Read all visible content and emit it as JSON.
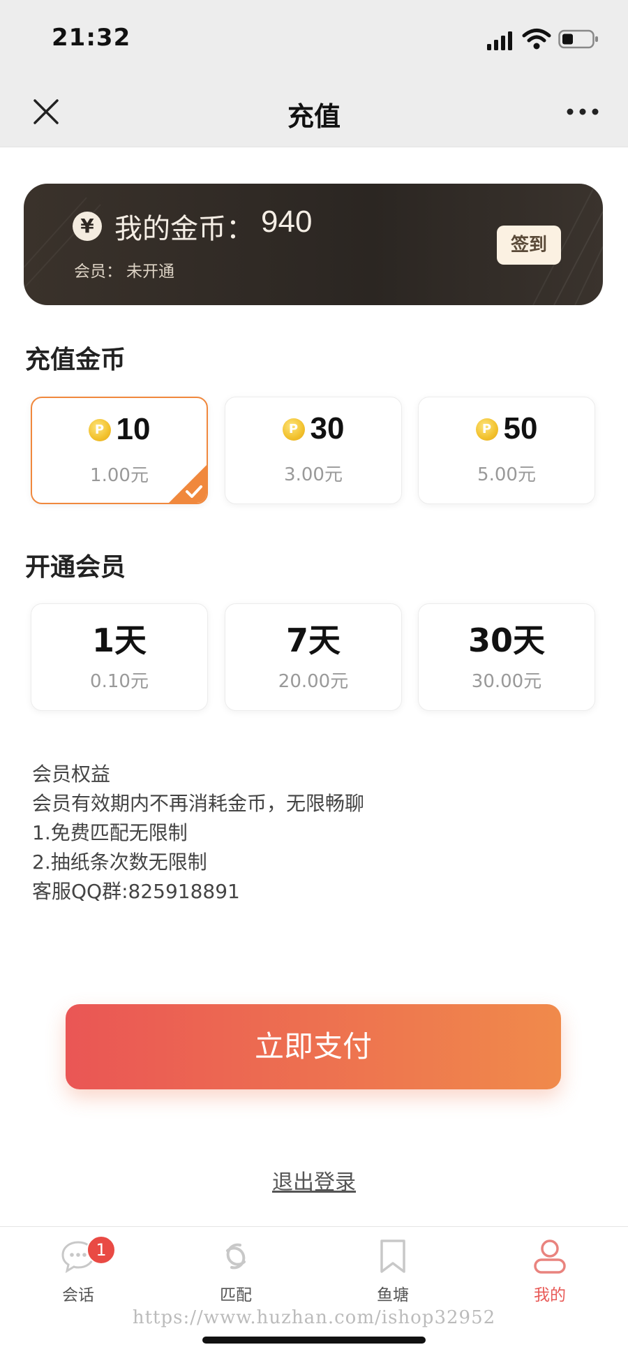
{
  "status_bar": {
    "time": "21:32"
  },
  "nav": {
    "title": "充值"
  },
  "wallet": {
    "coin_symbol": "¥",
    "coins_label": "我的金币：",
    "coins_value": "940",
    "member_label": "会员：",
    "member_status": "未开通",
    "checkin_label": "签到"
  },
  "recharge": {
    "title": "充值金币",
    "options": [
      {
        "amount": "10",
        "price": "1.00元",
        "selected": true
      },
      {
        "amount": "30",
        "price": "3.00元",
        "selected": false
      },
      {
        "amount": "50",
        "price": "5.00元",
        "selected": false
      }
    ]
  },
  "membership": {
    "title": "开通会员",
    "options": [
      {
        "days": "1天",
        "price": "0.10元"
      },
      {
        "days": "7天",
        "price": "20.00元"
      },
      {
        "days": "30天",
        "price": "30.00元"
      }
    ]
  },
  "benefits": {
    "lines": [
      "会员权益",
      "会员有效期内不再消耗金币，无限畅聊",
      "1.免费匹配无限制",
      "2.抽纸条次数无限制",
      "客服QQ群:825918891"
    ]
  },
  "pay_button": "立即支付",
  "logout_link": "退出登录",
  "tabbar": {
    "tabs": [
      {
        "label": "会话",
        "icon": "chat-bubble-icon",
        "badge": "1"
      },
      {
        "label": "匹配",
        "icon": "match-swirl-icon"
      },
      {
        "label": "鱼塘",
        "icon": "bookmark-icon"
      },
      {
        "label": "我的",
        "icon": "user-profile-icon",
        "active": true
      }
    ]
  },
  "watermark": "https://www.huzhan.com/ishop32952",
  "colors": {
    "accent": "#f0883d",
    "pay_gradient_start": "#ea5655",
    "pay_gradient_end": "#f08a4b",
    "active_tab": "#e85a57"
  }
}
